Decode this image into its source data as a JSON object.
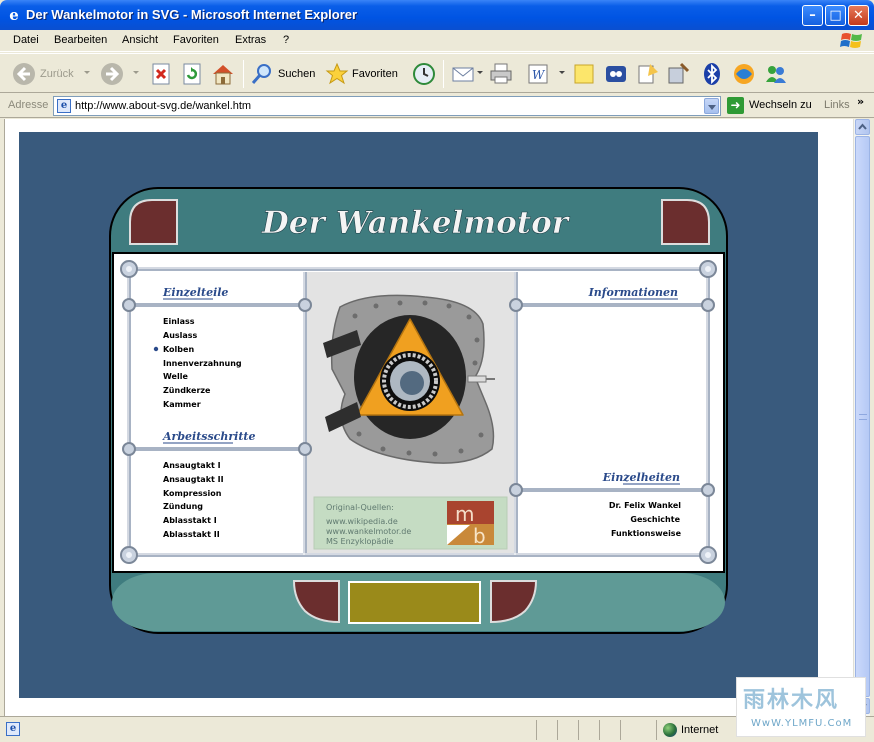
{
  "window": {
    "title": "Der Wankelmotor in SVG - Microsoft Internet Explorer",
    "minimize": "–",
    "maximize": "□",
    "close": "✕"
  },
  "menu": {
    "items": [
      "Datei",
      "Bearbeiten",
      "Ansicht",
      "Favoriten",
      "Extras",
      "?"
    ]
  },
  "toolbar": {
    "back_label": "Zurück",
    "search_label": "Suchen",
    "favorites_label": "Favoriten",
    "icons": [
      "back-icon",
      "forward-icon",
      "stop-icon",
      "refresh-icon",
      "home-icon",
      "search-icon",
      "favorites-icon",
      "history-icon",
      "mail-icon",
      "print-icon",
      "edit-icon",
      "notes-icon",
      "messenger-icon",
      "research-icon",
      "bluetooth-icon",
      "msn-icon"
    ]
  },
  "address": {
    "label": "Adresse",
    "url": "http://www.about-svg.de/wankel.htm",
    "go_label": "Wechseln zu",
    "links_label": "Links",
    "more": "»"
  },
  "page": {
    "title": "Der Wankelmotor",
    "left_panel": {
      "header1": "Einzelteile",
      "parts": [
        "Einlass",
        "Auslass",
        "Kolben",
        "Innenverzahnung",
        "Welle",
        "Zündkerze",
        "Kammer"
      ],
      "selected_part": "Kolben",
      "header2": "Arbeitsschritte",
      "steps": [
        "Ansaugtakt I",
        "Ansaugtakt II",
        "Kompression",
        "Zündung",
        "Ablasstakt I",
        "Ablasstakt II"
      ]
    },
    "sources": {
      "heading": "Original-Quellen:",
      "lines": [
        "www.wikipedia.de",
        "www.wankelmotor.de",
        "MS Enzyklopädie"
      ],
      "logo_letters": [
        "m",
        "b"
      ]
    },
    "right_panel": {
      "header1": "Informationen",
      "header2": "Einzelheiten",
      "items": [
        "Dr. Felix Wankel",
        "Geschichte",
        "Funktionsweise"
      ]
    }
  },
  "status": {
    "zone": "Internet"
  },
  "watermark": {
    "main": "雨林木风",
    "sub": "WwW.YLMFU.CoM"
  },
  "colors": {
    "titlebar": "#0054e3",
    "page_background": "#395a7d",
    "frame_teal": "#3f7c7f",
    "frame_light_teal": "#5f9a96",
    "corner_maroon": "#6b2e2e",
    "center_panel": "#e3e3e3",
    "header_text": "#2a4a8a",
    "rotor_orange": "#f0a020",
    "bottom_button": "#9a8a1a",
    "source_box": "#c5dcc3"
  }
}
